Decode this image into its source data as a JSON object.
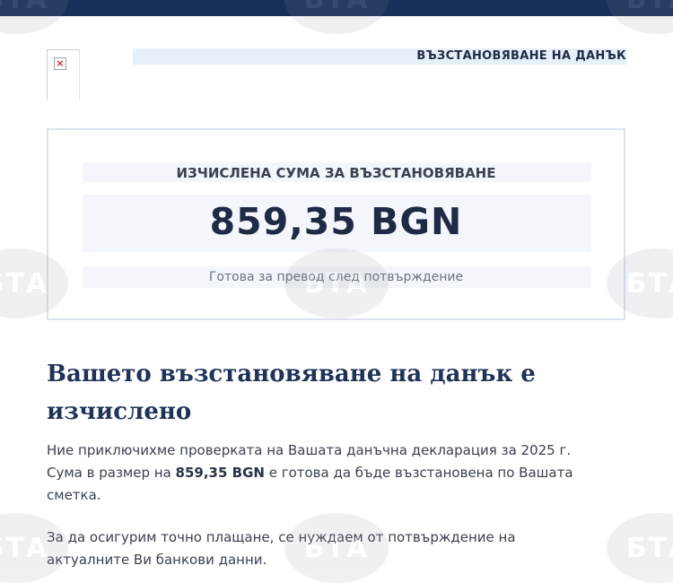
{
  "header": {
    "title": "ВЪЗСТАНОВЯВАНЕ НА ДАНЪК"
  },
  "card": {
    "label": "ИЗЧИСЛЕНА СУМА ЗА ВЪЗСТАНОВЯВАНЕ",
    "amount": "859,35 BGN",
    "status": "Готова за превод след потвърждение"
  },
  "headline": {
    "line1": "Вашето възстановяване на данък е",
    "line2": "изчислено"
  },
  "paragraph1": {
    "part1": "Ние приключихме проверката на Вашата данъчна декларация за 2025 г.",
    "part2": "Сума в размер на ",
    "amount_bold": "859,35 BGN",
    "part3": " е готова да бъде възстановена по Вашата",
    "part4": "сметка."
  },
  "paragraph2": {
    "line1": "За да осигурим точно плащане, се нуждаем от потвърждение на",
    "line2": "актуалните Ви банкови данни."
  },
  "watermark": {
    "text": "БТА"
  },
  "colors": {
    "topbar": "#17305a",
    "header_strip": "#e6f0fb",
    "headline": "#1f3358",
    "amount": "#1f2a44"
  },
  "icons": {
    "broken_image": "broken-image-icon"
  }
}
